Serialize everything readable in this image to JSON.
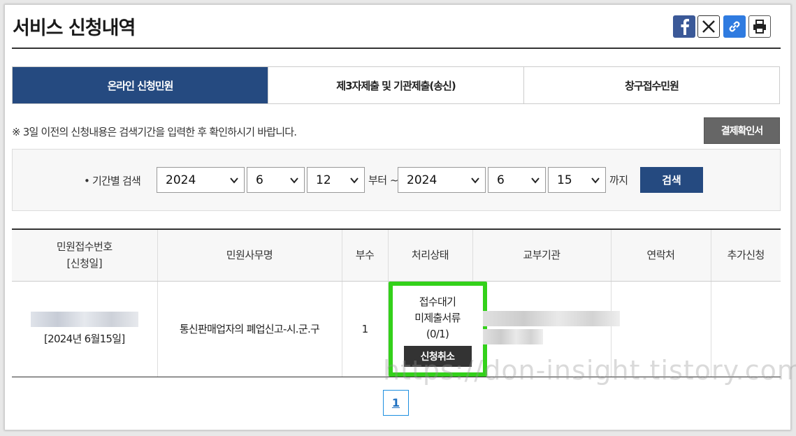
{
  "page": {
    "title": "서비스 신청내역"
  },
  "share": [
    {
      "name": "facebook-icon",
      "color": "#3b5998"
    },
    {
      "name": "x-icon",
      "color": "#ffffff"
    },
    {
      "name": "link-icon",
      "color": "#2f7be0"
    },
    {
      "name": "print-icon",
      "color": "#ffffff"
    }
  ],
  "tabs": [
    {
      "label": "온라인 신청민원",
      "active": true
    },
    {
      "label": "제3자제출 및 기관제출(송신)",
      "active": false
    },
    {
      "label": "창구접수민원",
      "active": false
    }
  ],
  "notice": "※ 3일 이전의 신청내용은 검색기간을 입력한 후 확인하시기 바랍니다.",
  "receipt_button": "결제확인서",
  "search": {
    "label": "기간별 검색",
    "from_year": "2024",
    "from_month": "6",
    "from_day": "12",
    "from_word": "부터 ~",
    "to_year": "2024",
    "to_month": "6",
    "to_day": "15",
    "to_word": "까지",
    "button": "검색"
  },
  "table": {
    "headers": [
      "민원접수번호\n[신청일]",
      "민원사무명",
      "부수",
      "처리상태",
      "교부기관",
      "연락처",
      "추가신청"
    ],
    "header_receipt_line1": "민원접수번호",
    "header_receipt_line2": "[신청일]",
    "rows": [
      {
        "apply_date": "[2024년 6월15일]",
        "service_name": "통신판매업자의 폐업신고-시.군.구",
        "copies": "1",
        "status_line1": "접수대기",
        "status_line2": "미제출서류",
        "status_line3": "(0/1)",
        "cancel_label": "신청취소"
      }
    ]
  },
  "accent": {
    "highlight": "#33d11a",
    "navy": "#254a80"
  },
  "pagination": {
    "current": "1"
  },
  "watermark": "https://don-insight.tistory.com"
}
